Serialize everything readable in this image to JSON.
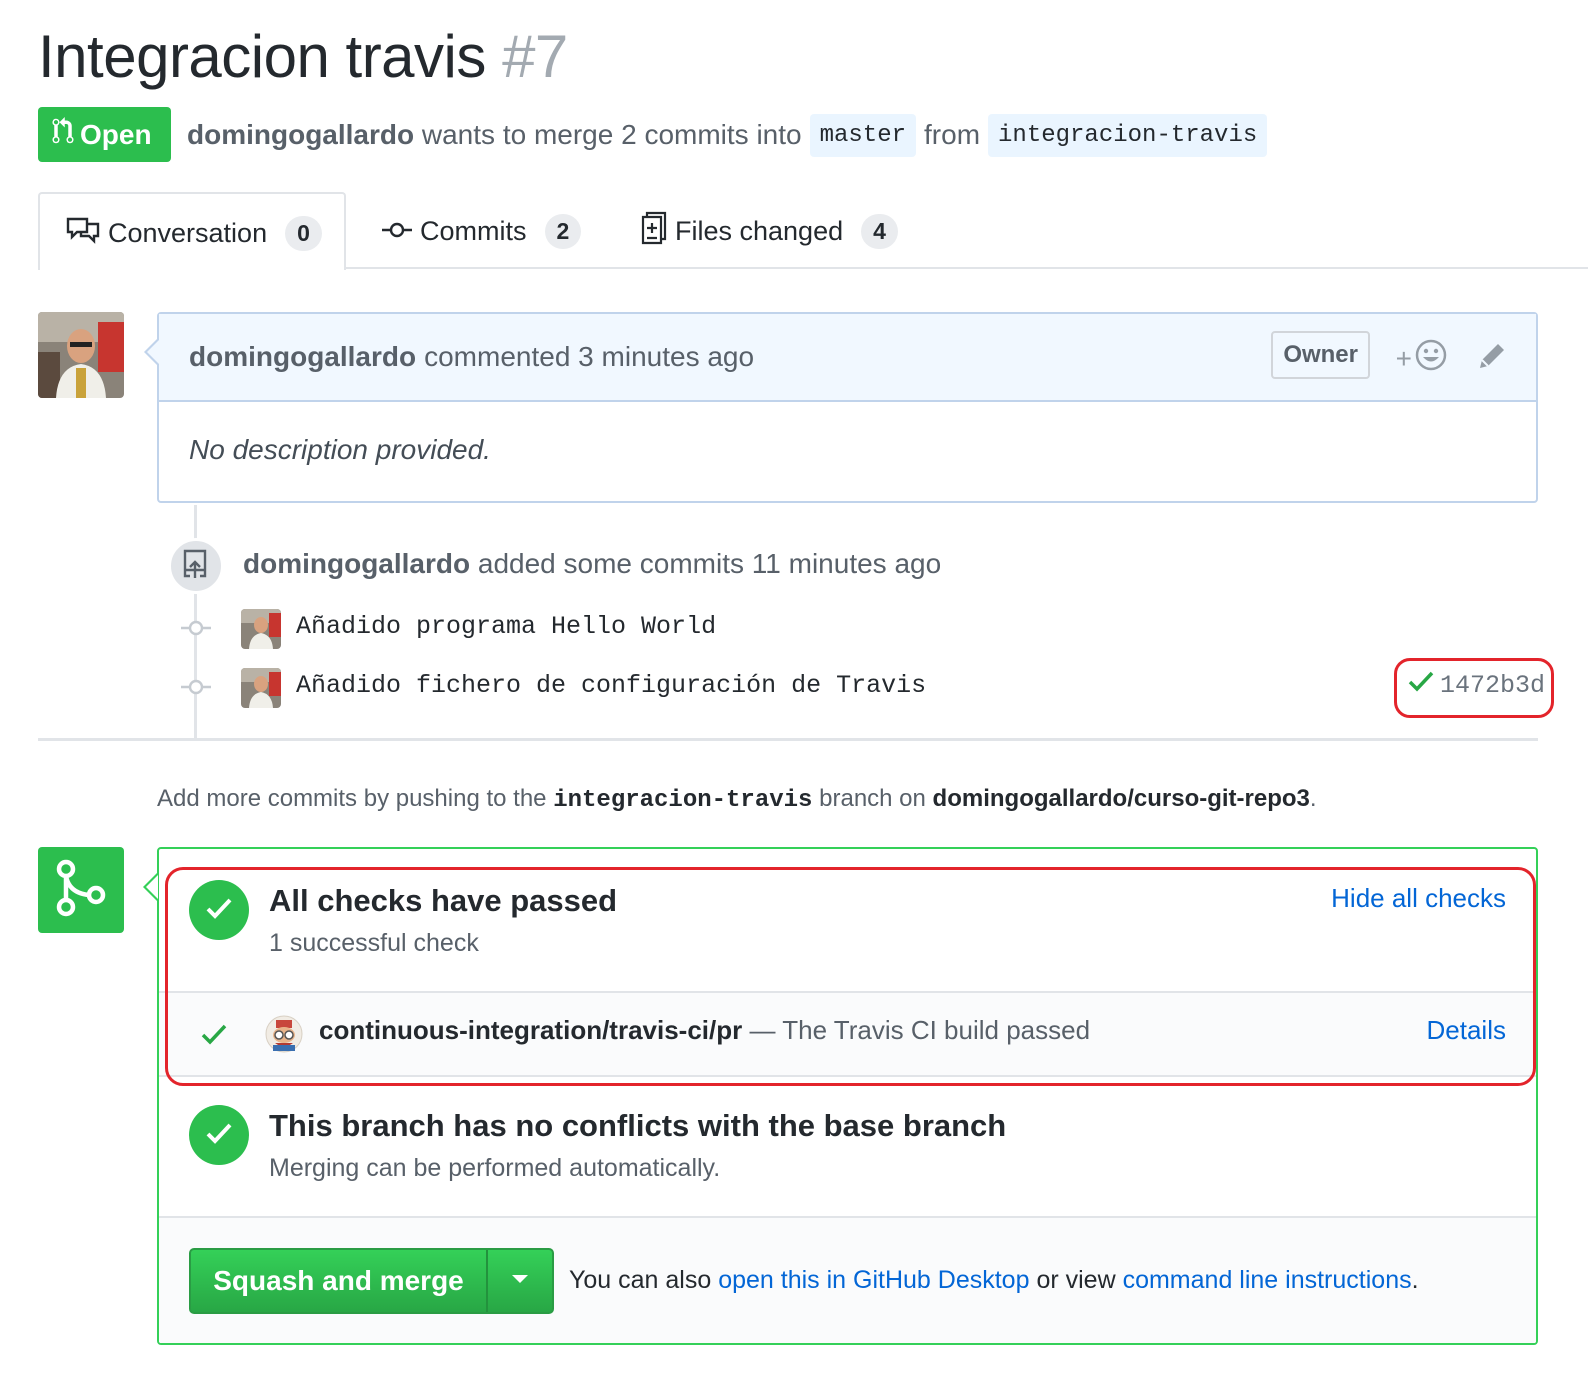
{
  "pr": {
    "title": "Integracion travis",
    "number": "#7",
    "state": "Open",
    "author": "domingogallardo",
    "merge_text": "wants to merge 2 commits into",
    "base_branch": "master",
    "from_text": "from",
    "head_branch": "integracion-travis"
  },
  "tabs": [
    {
      "label": "Conversation",
      "count": "0",
      "icon": "comment-discussion-icon"
    },
    {
      "label": "Commits",
      "count": "2",
      "icon": "git-commit-icon"
    },
    {
      "label": "Files changed",
      "count": "4",
      "icon": "diff-icon"
    }
  ],
  "comment": {
    "author": "domingogallardo",
    "action": "commented 3 minutes ago",
    "badge": "Owner",
    "reaction_plus": "+",
    "body": "No description provided."
  },
  "push_event": {
    "author": "domingogallardo",
    "text": "added some commits 11 minutes ago",
    "commits": [
      {
        "message": "Añadido programa Hello World"
      },
      {
        "message": "Añadido fichero de configuración de Travis",
        "sha": "1472b3d",
        "status": "success"
      }
    ]
  },
  "push_hint": {
    "prefix": "Add more commits by pushing to the",
    "branch": "integracion-travis",
    "middle": "branch on",
    "repo": "domingogallardo/curso-git-repo3",
    "suffix": "."
  },
  "checks": {
    "title": "All checks have passed",
    "subtitle": "1 successful check",
    "toggle_link": "Hide all checks",
    "items": [
      {
        "context": "continuous-integration/travis-ci/pr",
        "description": "— The Travis CI build passed",
        "details_link": "Details"
      }
    ]
  },
  "conflicts": {
    "title": "This branch has no conflicts with the base branch",
    "subtitle": "Merging can be performed automatically."
  },
  "merge": {
    "button_label": "Squash and merge",
    "also_text": "You can also",
    "desktop_link": "open this in GitHub Desktop",
    "or_view": "or view",
    "cli_link": "command line instructions",
    "end": "."
  },
  "colors": {
    "green": "#2cbe4e",
    "link": "#0366d6",
    "highlight_red": "#e3242b",
    "comment_header": "#f1f8ff"
  }
}
